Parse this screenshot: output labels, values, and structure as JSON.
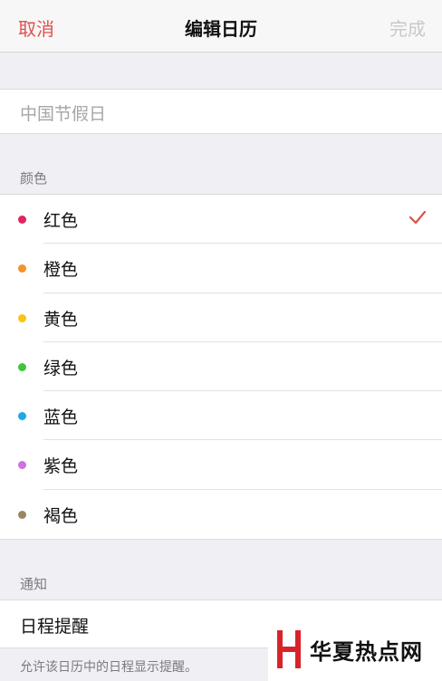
{
  "nav": {
    "cancel": "取消",
    "title": "编辑日历",
    "done": "完成"
  },
  "name_field": {
    "placeholder": "中国节假日"
  },
  "colors_section": {
    "header": "颜色",
    "selected": "红色",
    "items": [
      {
        "label": "红色",
        "color": "#e0245e",
        "selected": true
      },
      {
        "label": "橙色",
        "color": "#f5922a",
        "selected": false
      },
      {
        "label": "黄色",
        "color": "#f5c518",
        "selected": false
      },
      {
        "label": "绿色",
        "color": "#3ec63a",
        "selected": false
      },
      {
        "label": "蓝色",
        "color": "#1fa7e6",
        "selected": false
      },
      {
        "label": "紫色",
        "color": "#cc73e1",
        "selected": false
      },
      {
        "label": "褐色",
        "color": "#9c8563",
        "selected": false
      }
    ]
  },
  "notifications_section": {
    "header": "通知",
    "row_label": "日程提醒",
    "footnote": "允许该日历中的日程显示提醒。"
  },
  "watermark": {
    "text": "华夏热点网",
    "color": "#d9232a"
  },
  "accent_color": "#e0504c"
}
